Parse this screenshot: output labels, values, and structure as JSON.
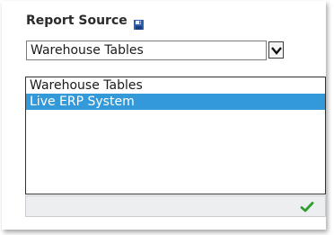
{
  "panel": {
    "title": "Report Source",
    "title_icon": "save-disk-icon"
  },
  "select": {
    "value": "Warehouse Tables",
    "dropdown_icon": "chevron-down-icon"
  },
  "list": {
    "options": [
      {
        "label": "Warehouse Tables",
        "selected": false
      },
      {
        "label": "Live ERP System",
        "selected": true
      }
    ],
    "selected_color": "#3399d8"
  },
  "footer": {
    "confirm_icon": "checkmark-icon",
    "confirm_color": "#2e9e2e"
  }
}
